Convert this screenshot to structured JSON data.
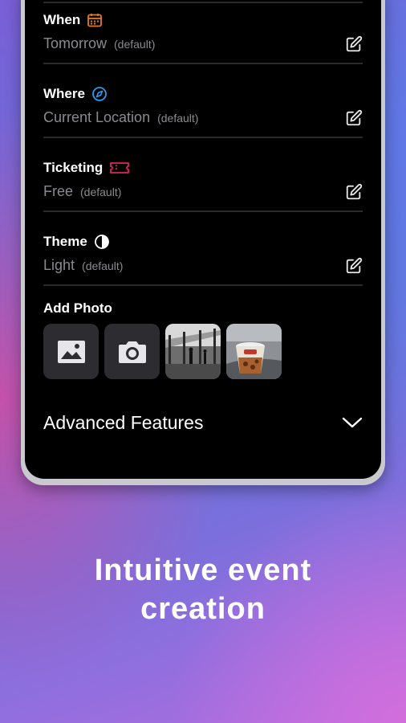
{
  "form": {
    "fields": [
      {
        "label": "When",
        "icon": "calendar-icon",
        "icon_color": "#e07a2a",
        "value": "Tomorrow",
        "hint": "(default)"
      },
      {
        "label": "Where",
        "icon": "compass-icon",
        "icon_color": "#2b9bf0",
        "value": "Current Location",
        "hint": "(default)"
      },
      {
        "label": "Ticketing",
        "icon": "ticket-icon",
        "icon_color": "#e0245e",
        "value": "Free",
        "hint": "(default)"
      },
      {
        "label": "Theme",
        "icon": "contrast-icon",
        "icon_color": "#ffffff",
        "value": "Light",
        "hint": "(default)"
      }
    ],
    "add_photo_label": "Add Photo",
    "photo_options": [
      "image-gallery-icon",
      "camera-icon",
      "photo-thumbnail-airport",
      "photo-thumbnail-drink"
    ],
    "advanced_label": "Advanced Features"
  },
  "caption": {
    "line1": "Intuitive event",
    "line2": "creation"
  },
  "colors": {
    "screen_bg": "#000000",
    "tile_bg": "#2c2c31",
    "muted_text": "#8a8a90"
  }
}
